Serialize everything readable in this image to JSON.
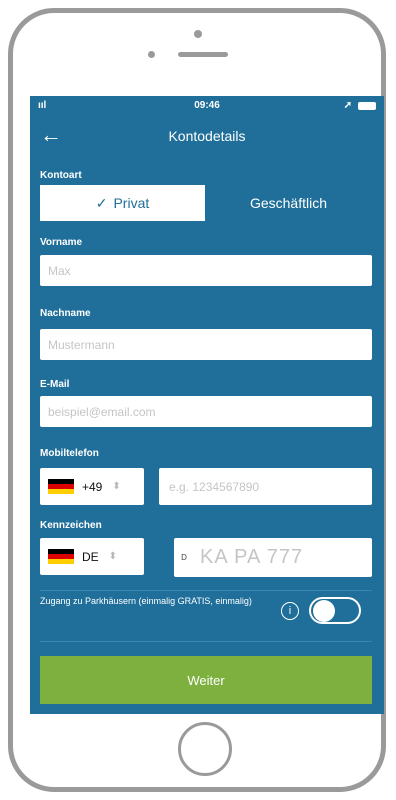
{
  "status": {
    "time": "09:46",
    "signal": "ııl"
  },
  "header": {
    "title": "Kontodetails"
  },
  "account_type": {
    "label": "Kontoart",
    "options": [
      "Privat",
      "Geschäftlich"
    ],
    "selected_check": "✓"
  },
  "fields": {
    "first_name": {
      "label": "Vorname",
      "placeholder": "Max"
    },
    "last_name": {
      "label": "Nachname",
      "placeholder": "Mustermann"
    },
    "email": {
      "label": "E-Mail",
      "placeholder": "beispiel@email.com"
    },
    "mobile": {
      "label": "Mobiltelefon",
      "country_code": "+49",
      "placeholder": "e.g. 1234567890"
    },
    "plate": {
      "label": "Kennzeichen",
      "country": "DE",
      "prefix": "D",
      "placeholder": "KA PA 777"
    }
  },
  "parking": {
    "text": "Zugang zu Parkhäusern (einmalig GRATIS, einmalig)",
    "info_symbol": "i"
  },
  "submit": {
    "label": "Weiter"
  },
  "colors": {
    "background": "#1f6f9a",
    "button": "#7db03e"
  }
}
